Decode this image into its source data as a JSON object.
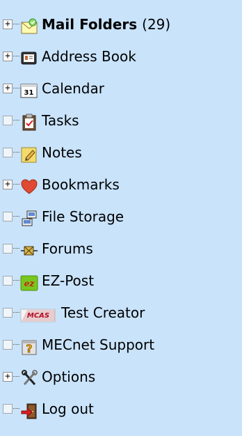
{
  "tree": {
    "items": [
      {
        "label": "Mail Folders",
        "count": "(29)",
        "toggle": "+",
        "icon": "mail-icon"
      },
      {
        "label": "Address Book",
        "toggle": "+",
        "icon": "address-book-icon"
      },
      {
        "label": "Calendar",
        "toggle": "+",
        "icon": "calendar-icon",
        "icon_text": "31"
      },
      {
        "label": "Tasks",
        "toggle": "",
        "icon": "tasks-icon"
      },
      {
        "label": "Notes",
        "toggle": "",
        "icon": "notes-icon"
      },
      {
        "label": "Bookmarks",
        "toggle": "+",
        "icon": "heart-icon"
      },
      {
        "label": "File Storage",
        "toggle": "",
        "icon": "file-storage-icon"
      },
      {
        "label": "Forums",
        "toggle": "",
        "icon": "forums-icon"
      },
      {
        "label": "EZ-Post",
        "toggle": "",
        "icon": "ez-post-icon",
        "icon_text": "ez"
      },
      {
        "label": "Test Creator",
        "toggle": "",
        "icon": "mcas-icon",
        "icon_text": "MCAS"
      },
      {
        "label": "MECnet Support",
        "toggle": "",
        "icon": "support-icon"
      },
      {
        "label": "Options",
        "toggle": "+",
        "icon": "tools-icon"
      },
      {
        "label": "Log out",
        "toggle": "",
        "icon": "logout-icon"
      }
    ]
  },
  "colors": {
    "background": "#c9e3fb",
    "heart": "#e04a32",
    "mcas_red": "#b20f25",
    "ez_green": "#79c71e"
  }
}
